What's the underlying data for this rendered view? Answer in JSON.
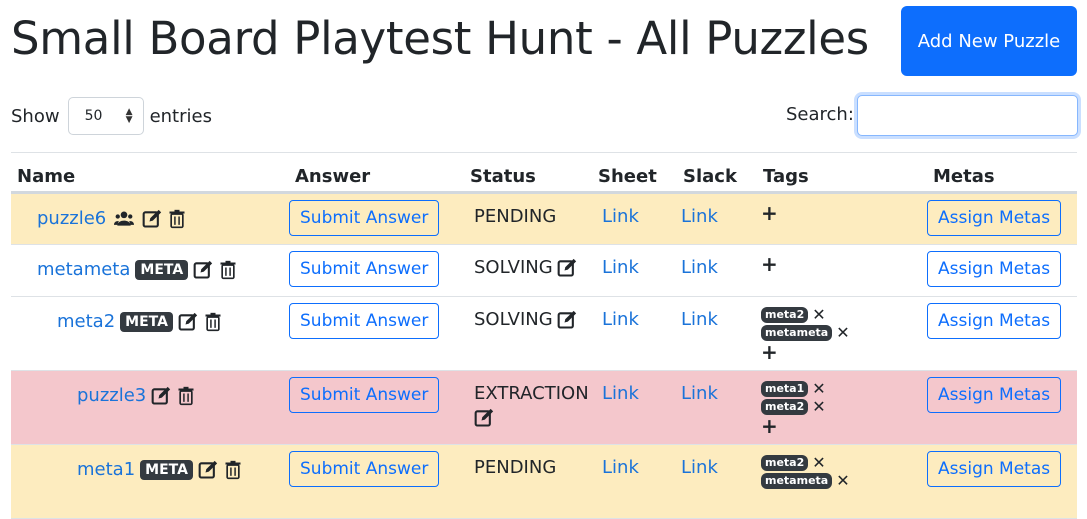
{
  "header": {
    "title": "Small Board Playtest Hunt - All Puzzles",
    "add_button": "Add New Puzzle"
  },
  "controls": {
    "show_label": "Show",
    "page_size": "50",
    "entries_label": "entries",
    "search_label": "Search:",
    "search_value": ""
  },
  "table": {
    "headers": [
      "Name",
      "Answer",
      "Status",
      "Sheet",
      "Slack",
      "Tags",
      "Metas"
    ],
    "rows": [
      {
        "name": "puzzle6",
        "meta_badge": "",
        "answer_button": "Submit Answer",
        "status": "PENDING",
        "sheet": "Link",
        "slack": "Link",
        "tags": [],
        "metas_button": "Assign Metas"
      },
      {
        "name": "metameta",
        "meta_badge": "META",
        "answer_button": "Submit Answer",
        "status": "SOLVING",
        "sheet": "Link",
        "slack": "Link",
        "tags": [],
        "metas_button": "Assign Metas"
      },
      {
        "name": "meta2",
        "meta_badge": "META",
        "answer_button": "Submit Answer",
        "status": "SOLVING",
        "sheet": "Link",
        "slack": "Link",
        "tags": [
          "meta2",
          "metameta"
        ],
        "metas_button": "Assign Metas"
      },
      {
        "name": "puzzle3",
        "meta_badge": "",
        "answer_button": "Submit Answer",
        "status": "EXTRACTION",
        "sheet": "Link",
        "slack": "Link",
        "tags": [
          "meta1",
          "meta2"
        ],
        "metas_button": "Assign Metas"
      },
      {
        "name": "meta1",
        "meta_badge": "META",
        "answer_button": "Submit Answer",
        "status": "PENDING",
        "sheet": "Link",
        "slack": "Link",
        "tags": [
          "meta2",
          "metameta"
        ],
        "metas_button": "Assign Metas"
      }
    ]
  },
  "icons": {
    "team": "users-icon",
    "edit": "edit-icon",
    "delete": "trash-icon",
    "add_tag": "plus-icon",
    "remove_tag": "close-icon"
  },
  "colors": {
    "primary": "#0d6efd",
    "link": "#1a73d9",
    "pending_row": "#fdecbf",
    "extraction_row": "#f4c7cc",
    "badge": "#343a40"
  }
}
